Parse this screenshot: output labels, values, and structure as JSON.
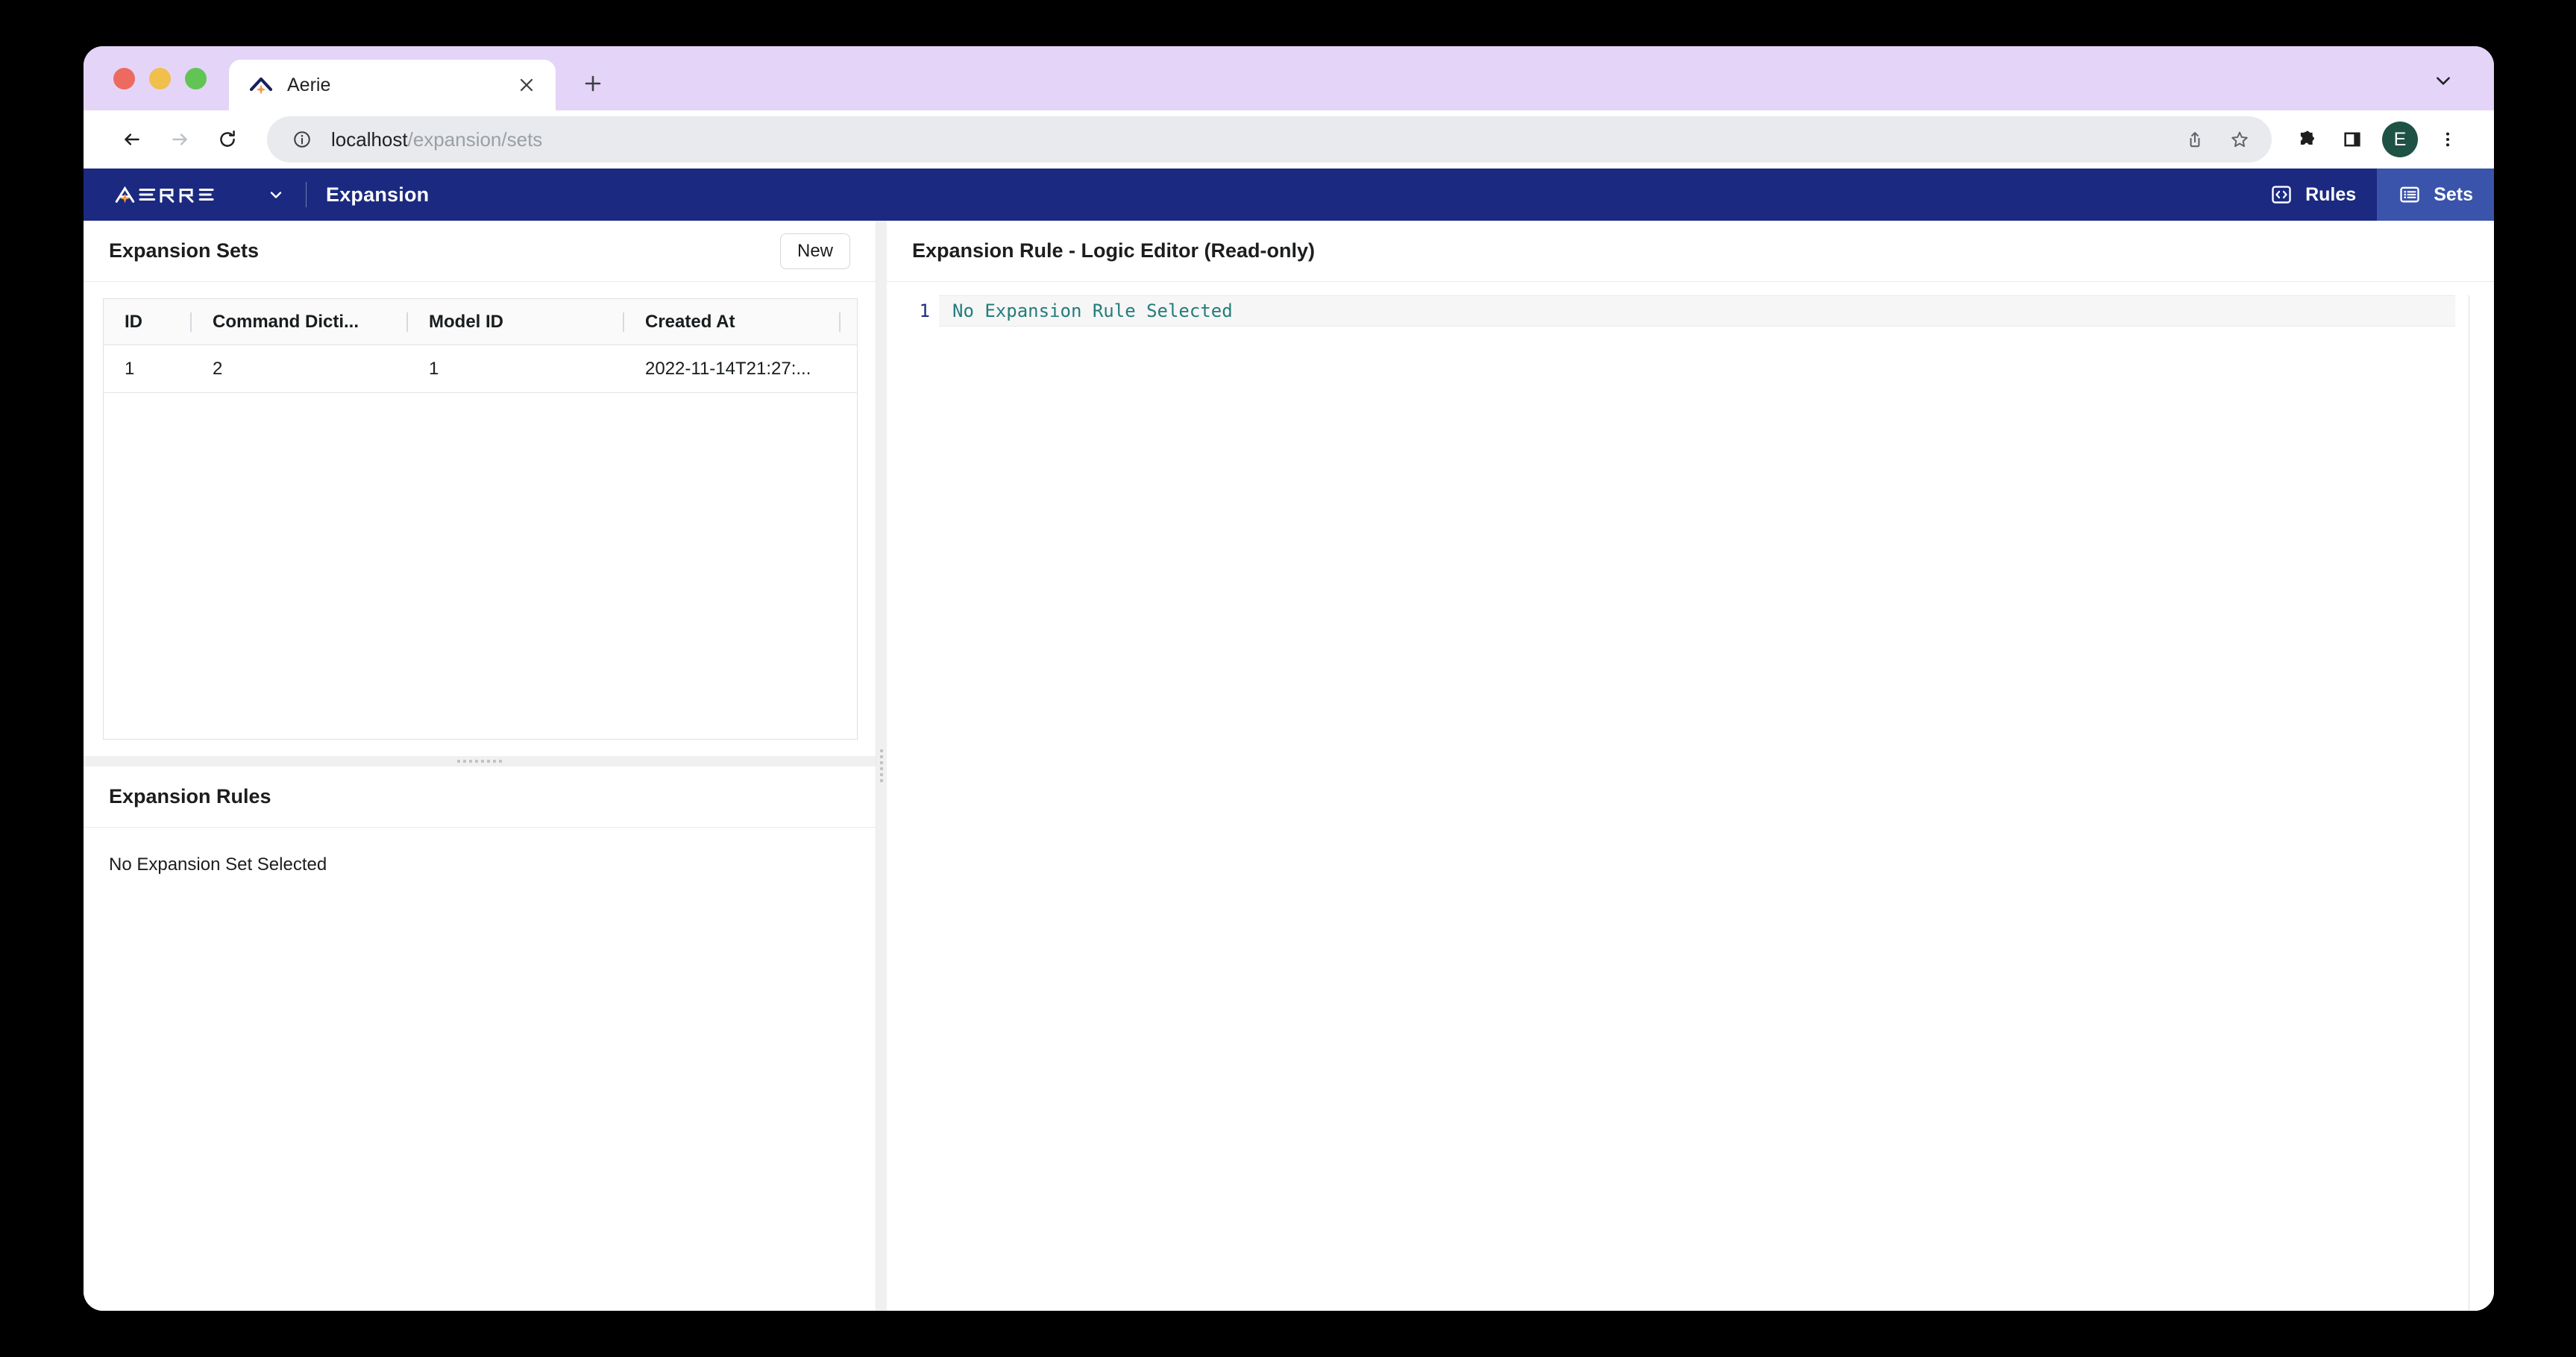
{
  "browser": {
    "tab": {
      "title": "Aerie",
      "favicon_icon": "aerie-chevron-icon",
      "close_icon": "close-icon"
    },
    "new_tab_icon": "plus-icon",
    "tabstrip_chevron_icon": "chevron-down-icon",
    "nav": {
      "back_icon": "back-arrow-icon",
      "forward_icon": "forward-arrow-icon",
      "reload_icon": "reload-icon"
    },
    "omnibox": {
      "info_icon": "info-circle-icon",
      "url_host": "localhost",
      "url_path": "/expansion/sets",
      "share_icon": "share-icon",
      "bookmark_icon": "star-icon"
    },
    "toolbar_right": {
      "extensions_icon": "puzzle-piece-icon",
      "side_panel_icon": "side-panel-icon",
      "avatar_initial": "E",
      "menu_icon": "three-dot-menu-icon"
    }
  },
  "app": {
    "brand": "AERIE",
    "brand_caret_icon": "chevron-down-icon",
    "title": "Expansion",
    "nav": [
      {
        "label": "Rules",
        "icon": "code-brackets-icon",
        "active": false
      },
      {
        "label": "Sets",
        "icon": "list-icon",
        "active": true
      }
    ],
    "accent_navy": "#1b2a80",
    "accent_active": "#3a54ab"
  },
  "sets_panel": {
    "title": "Expansion Sets",
    "new_button": "New",
    "columns": [
      "ID",
      "Command Dicti...",
      "Model ID",
      "Created At"
    ],
    "rows": [
      {
        "id": "1",
        "command_dictionary": "2",
        "model_id": "1",
        "created_at": "2022-11-14T21:27:..."
      }
    ]
  },
  "rules_panel": {
    "title": "Expansion Rules",
    "empty_message": "No Expansion Set Selected"
  },
  "editor_panel": {
    "title": "Expansion Rule - Logic Editor (Read-only)",
    "line_number": "1",
    "line_text": "No Expansion Rule Selected",
    "text_color": "#227d7a",
    "gutter_color": "#1b2a80"
  }
}
